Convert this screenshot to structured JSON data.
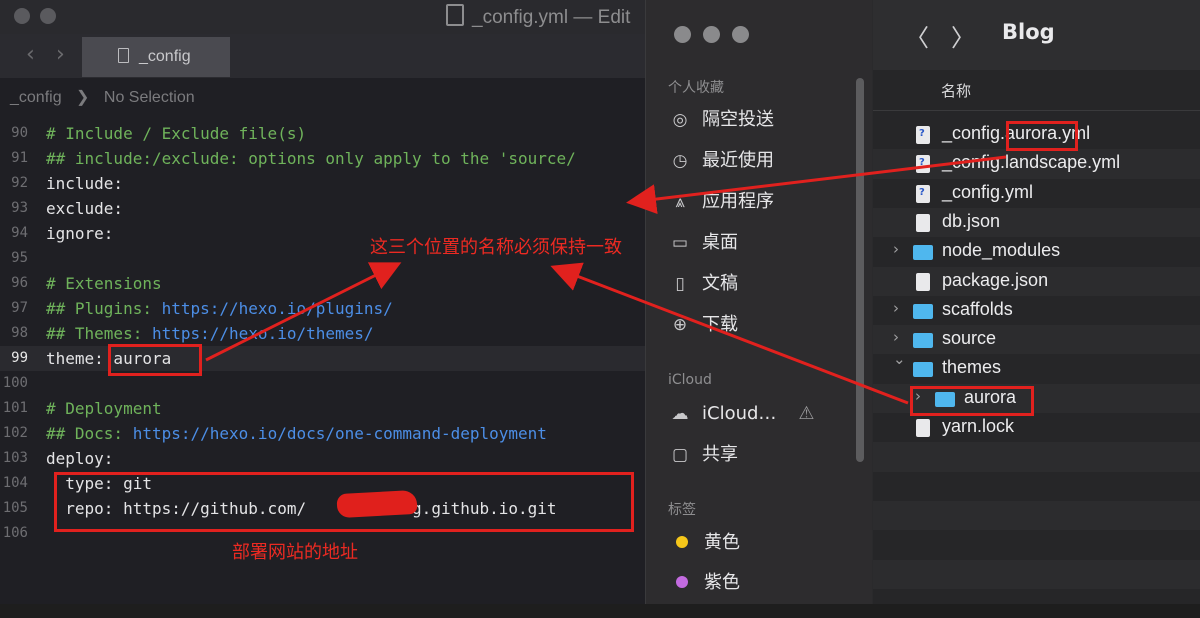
{
  "editor": {
    "window_title": "_config.yml — Edit",
    "tab_label": "_config",
    "breadcrumb": {
      "file": "_config",
      "separator": "❯",
      "selection": "No Selection"
    },
    "code_lines": [
      {
        "n": "90",
        "text": "# Include / Exclude file(s)",
        "kind": "comment"
      },
      {
        "n": "91",
        "text": "## include:/exclude: options only apply to the 'source/",
        "kind": "comment"
      },
      {
        "n": "92",
        "text": "include:",
        "kind": "key"
      },
      {
        "n": "93",
        "text": "exclude:",
        "kind": "key"
      },
      {
        "n": "94",
        "text": "ignore:",
        "kind": "key"
      },
      {
        "n": "95",
        "text": "",
        "kind": "key"
      },
      {
        "n": "96",
        "text": "# Extensions",
        "kind": "comment"
      },
      {
        "n": "97",
        "prefix": "## Plugins: ",
        "link": "https://hexo.io/plugins/",
        "kind": "comment-link"
      },
      {
        "n": "98",
        "prefix": "## Themes: ",
        "link": "https://hexo.io/themes/",
        "kind": "comment-link"
      },
      {
        "n": "99",
        "text": "theme: aurora",
        "kind": "key",
        "current": true
      },
      {
        "n": "100",
        "text": "",
        "kind": "key"
      },
      {
        "n": "101",
        "text": "# Deployment",
        "kind": "comment"
      },
      {
        "n": "102",
        "prefix": "## Docs: ",
        "link": "https://hexo.io/docs/one-command-deployment",
        "kind": "comment-link"
      },
      {
        "n": "103",
        "text": "deploy:",
        "kind": "key"
      },
      {
        "n": "104",
        "text": "  type: git",
        "kind": "key"
      },
      {
        "n": "105",
        "text": "  repo: https://github.com/       /blog.github.io.git",
        "kind": "key"
      },
      {
        "n": "106",
        "text": "",
        "kind": "key"
      }
    ]
  },
  "finder": {
    "folder_title": "Blog",
    "column_header": "名称",
    "sidebar": {
      "favorites_header": "个人收藏",
      "favorites": [
        {
          "label": "隔空投送",
          "icon": "airdrop-icon",
          "glyph": "◎"
        },
        {
          "label": "最近使用",
          "icon": "clock-icon",
          "glyph": "◷"
        },
        {
          "label": "应用程序",
          "icon": "applications-icon",
          "glyph": "⩓"
        },
        {
          "label": "桌面",
          "icon": "desktop-icon",
          "glyph": "▭"
        },
        {
          "label": "文稿",
          "icon": "document-icon",
          "glyph": "▯"
        },
        {
          "label": "下载",
          "icon": "download-icon",
          "glyph": "⊕"
        }
      ],
      "icloud_header": "iCloud",
      "icloud": [
        {
          "label": "iCloud…",
          "icon": "cloud-icon",
          "glyph": "☁",
          "warning": "⚠"
        },
        {
          "label": "共享",
          "icon": "shared-folder-icon",
          "glyph": "▢"
        }
      ],
      "tags_header": "标签",
      "tags": [
        {
          "label": "黄色",
          "color": "#f5c71a"
        },
        {
          "label": "紫色",
          "color": "#c36be0"
        }
      ]
    },
    "files": [
      {
        "name": "_config.aurora.yml",
        "type": "yml",
        "level": 0,
        "expand": ""
      },
      {
        "name": "_config.landscape.yml",
        "type": "yml",
        "level": 0,
        "expand": ""
      },
      {
        "name": "_config.yml",
        "type": "yml",
        "level": 0,
        "expand": ""
      },
      {
        "name": "db.json",
        "type": "file",
        "level": 0,
        "expand": ""
      },
      {
        "name": "node_modules",
        "type": "folder",
        "level": 0,
        "expand": "›"
      },
      {
        "name": "package.json",
        "type": "file",
        "level": 0,
        "expand": ""
      },
      {
        "name": "scaffolds",
        "type": "folder",
        "level": 0,
        "expand": "›"
      },
      {
        "name": "source",
        "type": "folder",
        "level": 0,
        "expand": "›"
      },
      {
        "name": "themes",
        "type": "folder",
        "level": 0,
        "expand": "⌄"
      },
      {
        "name": "aurora",
        "type": "folder",
        "level": 1,
        "expand": "›"
      },
      {
        "name": "yarn.lock",
        "type": "file",
        "level": 0,
        "expand": ""
      }
    ]
  },
  "annotations": {
    "same_name_note": "这三个位置的名称必须保持一致",
    "deploy_note": "部署网站的地址",
    "accent_color": "#e1211e"
  }
}
